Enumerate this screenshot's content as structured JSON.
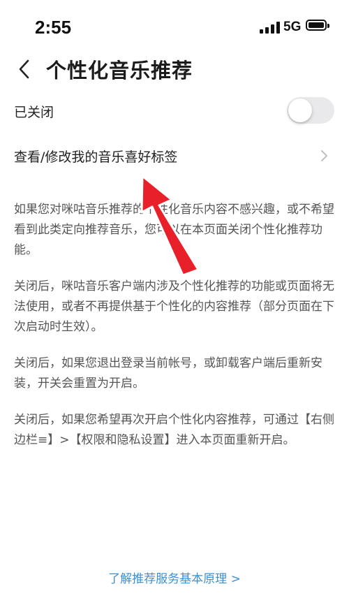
{
  "status_bar": {
    "time": "2:55",
    "network": "5G"
  },
  "header": {
    "title": "个性化音乐推荐"
  },
  "toggle": {
    "label": "已关闭",
    "state": "off"
  },
  "preference": {
    "label": "查看/修改我的音乐喜好标签"
  },
  "description": [
    "如果您对咪咕音乐推荐的个性化音乐内容不感兴趣，或不希望看到此类定向推荐音乐，您可以在本页面关闭个性化推荐功能。",
    "关闭后，咪咕音乐客户端内涉及个性化推荐的功能或页面将无法使用，或者不再提供基于个性化的内容推荐（部分页面在下次启动时生效）。",
    "关闭后，如果您退出登录当前帐号，或卸载客户端后重新安装，开关会重置为开启。",
    "关闭后，如果您希望再次开启个性化内容推荐，可通过【右侧边栏≡】>【权限和隐私设置】进入本页面重新开启。"
  ],
  "footer": {
    "link": "了解推荐服务基本原理 >"
  },
  "colors": {
    "link": "#3a8fd9",
    "toggle_off": "#e9e9eb",
    "arrow": "#e8202a"
  },
  "icons": [
    "signal-icon",
    "battery-icon",
    "back-icon",
    "chevron-right-icon",
    "annotation-arrow"
  ]
}
